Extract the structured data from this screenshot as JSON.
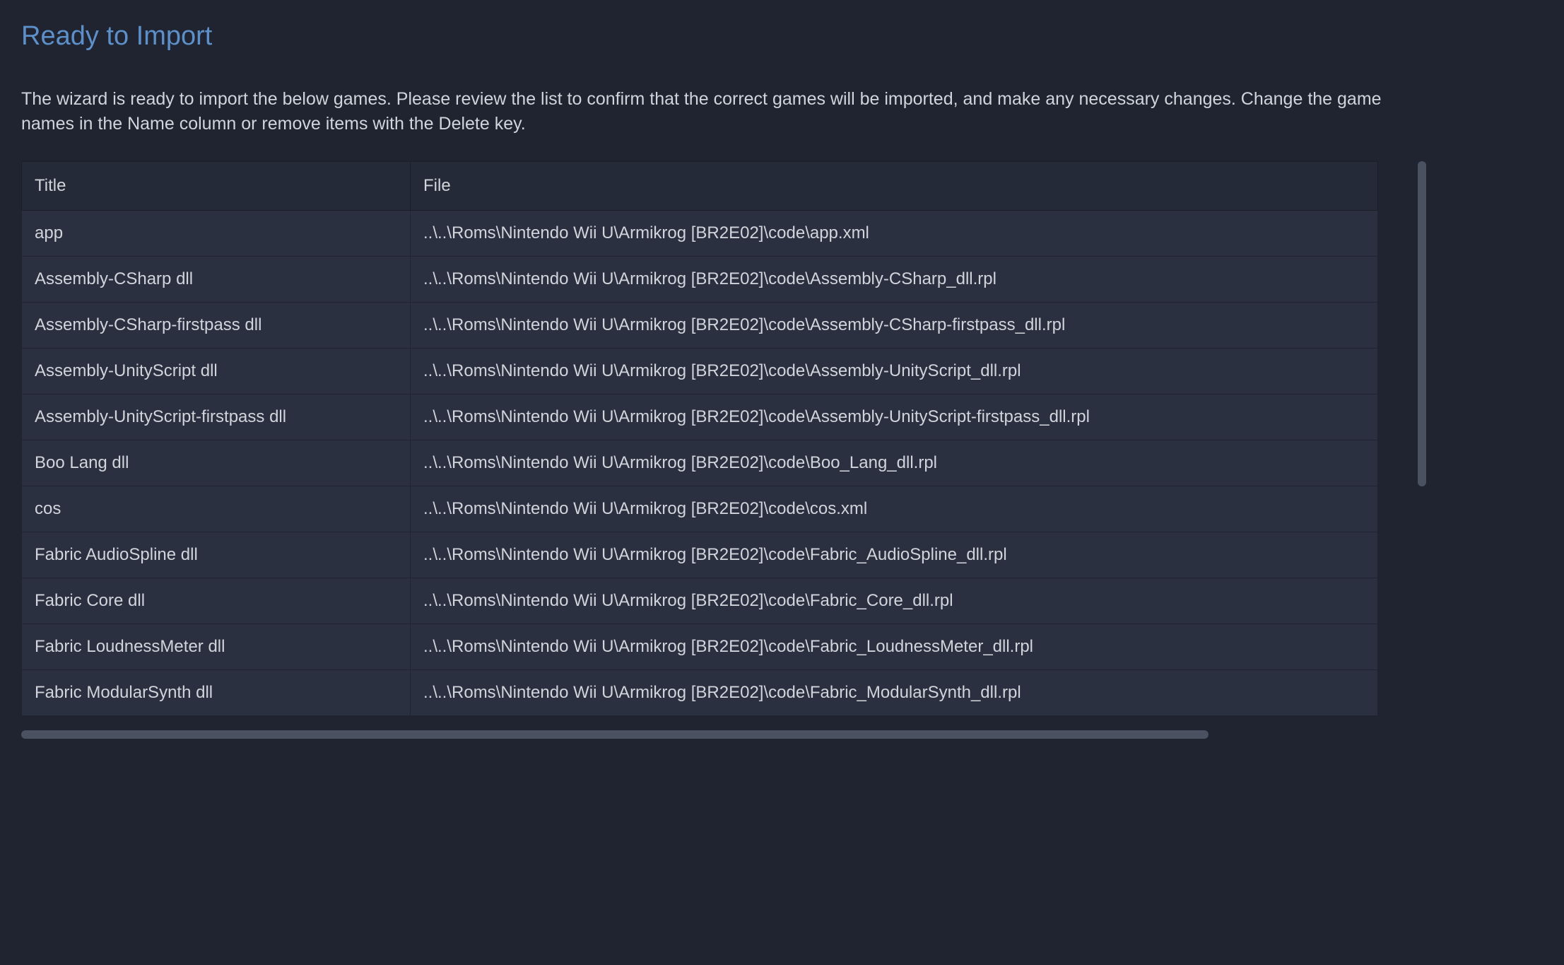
{
  "header": {
    "title": "Ready to Import"
  },
  "description": "The wizard is ready to import the below games. Please review the list to confirm that the correct games will be imported, and make any necessary changes. Change the game names in the Name column or remove items with the Delete key.",
  "table": {
    "columns": [
      "Title",
      "File"
    ],
    "rows": [
      {
        "title": "app",
        "file": "..\\..\\Roms\\Nintendo Wii U\\Armikrog [BR2E02]\\code\\app.xml"
      },
      {
        "title": "Assembly-CSharp dll",
        "file": "..\\..\\Roms\\Nintendo Wii U\\Armikrog [BR2E02]\\code\\Assembly-CSharp_dll.rpl"
      },
      {
        "title": "Assembly-CSharp-firstpass dll",
        "file": "..\\..\\Roms\\Nintendo Wii U\\Armikrog [BR2E02]\\code\\Assembly-CSharp-firstpass_dll.rpl"
      },
      {
        "title": "Assembly-UnityScript dll",
        "file": "..\\..\\Roms\\Nintendo Wii U\\Armikrog [BR2E02]\\code\\Assembly-UnityScript_dll.rpl"
      },
      {
        "title": "Assembly-UnityScript-firstpass dll",
        "file": "..\\..\\Roms\\Nintendo Wii U\\Armikrog [BR2E02]\\code\\Assembly-UnityScript-firstpass_dll.rpl"
      },
      {
        "title": "Boo Lang dll",
        "file": "..\\..\\Roms\\Nintendo Wii U\\Armikrog [BR2E02]\\code\\Boo_Lang_dll.rpl"
      },
      {
        "title": "cos",
        "file": "..\\..\\Roms\\Nintendo Wii U\\Armikrog [BR2E02]\\code\\cos.xml"
      },
      {
        "title": "Fabric AudioSpline dll",
        "file": "..\\..\\Roms\\Nintendo Wii U\\Armikrog [BR2E02]\\code\\Fabric_AudioSpline_dll.rpl"
      },
      {
        "title": "Fabric Core dll",
        "file": "..\\..\\Roms\\Nintendo Wii U\\Armikrog [BR2E02]\\code\\Fabric_Core_dll.rpl"
      },
      {
        "title": "Fabric LoudnessMeter dll",
        "file": "..\\..\\Roms\\Nintendo Wii U\\Armikrog [BR2E02]\\code\\Fabric_LoudnessMeter_dll.rpl"
      },
      {
        "title": "Fabric ModularSynth dll",
        "file": "..\\..\\Roms\\Nintendo Wii U\\Armikrog [BR2E02]\\code\\Fabric_ModularSynth_dll.rpl"
      }
    ]
  }
}
